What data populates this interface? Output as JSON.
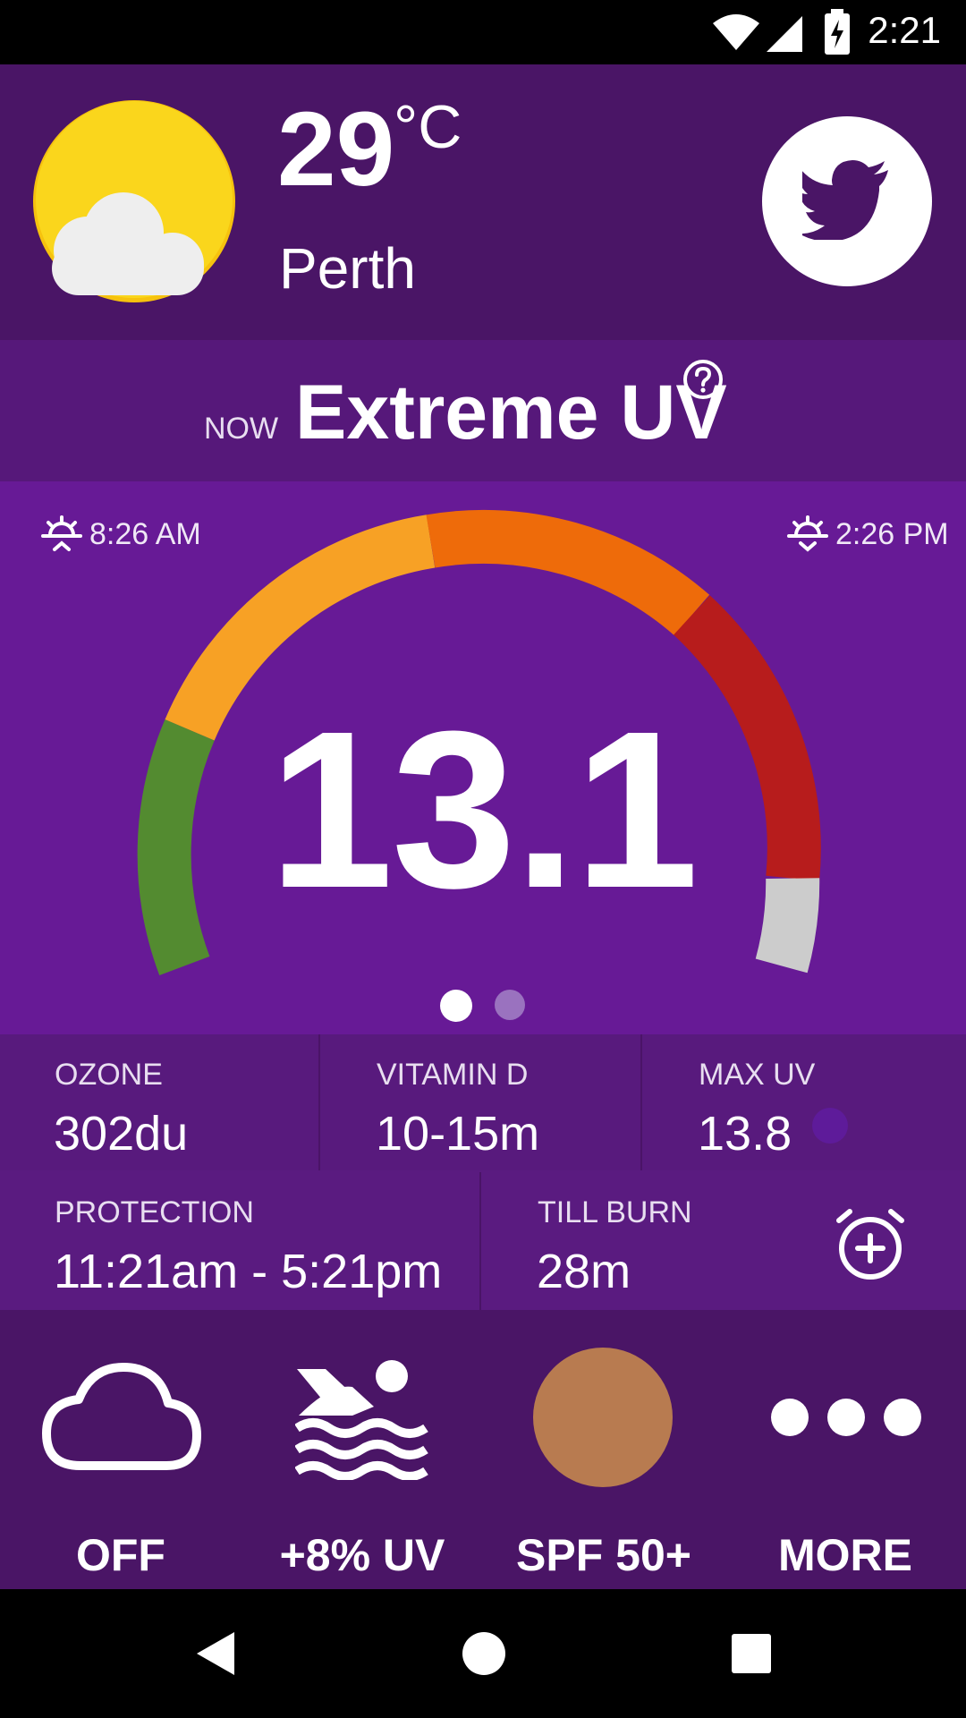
{
  "status_bar": {
    "time": "2:21"
  },
  "header": {
    "temperature": "29",
    "unit": "°C",
    "city": "Perth",
    "weather_icon": "partly-cloudy-icon",
    "share_icon": "twitter-icon"
  },
  "uv_status": {
    "now_label": "NOW",
    "level": "Extreme UV",
    "help_icon": "help-circle-icon"
  },
  "gauge": {
    "uv_index": "13.1",
    "sunrise_time": "8:26 AM",
    "sunset_time": "2:26 PM",
    "page_count": 2,
    "active_page": 1
  },
  "stats": {
    "ozone": {
      "label": "OZONE",
      "value": "302du"
    },
    "vitamin_d": {
      "label": "VITAMIN D",
      "value": "10-15m"
    },
    "max_uv": {
      "label": "MAX UV",
      "value": "13.8"
    },
    "protection": {
      "label": "PROTECTION",
      "value": "11:21am - 5:21pm"
    },
    "till_burn": {
      "label": "TILL BURN",
      "value": "28m"
    }
  },
  "actions": [
    {
      "icon": "cloud-icon",
      "label": "OFF"
    },
    {
      "icon": "swimming-icon",
      "label": "+8% UV"
    },
    {
      "icon": "skin-tone-icon",
      "label": "SPF 50+"
    },
    {
      "icon": "more-icon",
      "label": "MORE"
    }
  ],
  "colors": {
    "header_bg": "#4a1566",
    "gauge_bg": "#671a96",
    "skin_tone": "#b87b50"
  }
}
